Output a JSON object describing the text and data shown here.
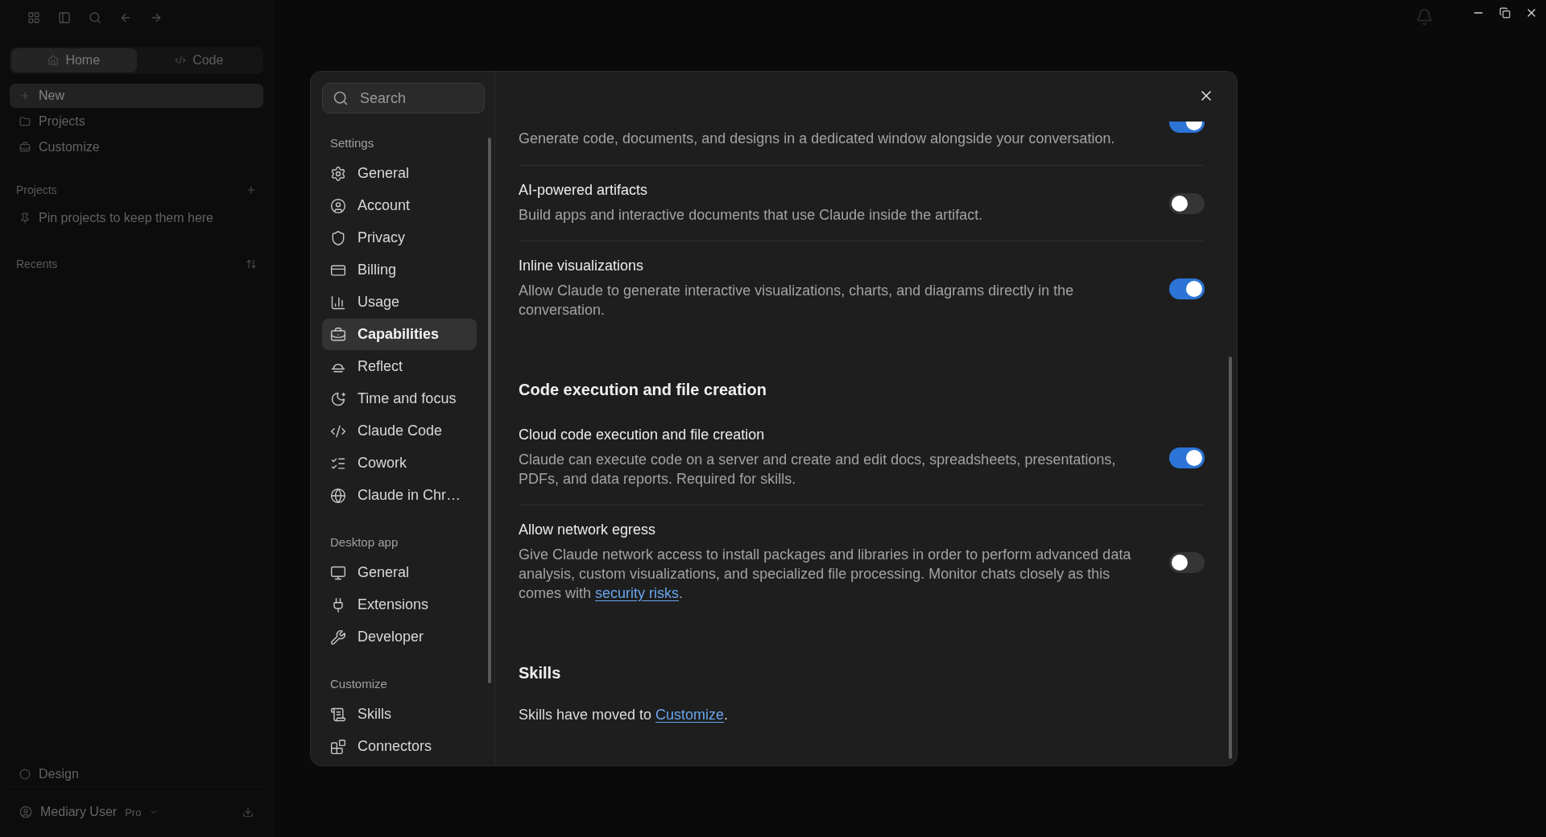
{
  "app_sidebar": {
    "tabs": [
      {
        "label": "Home",
        "selected": true
      },
      {
        "label": "Code",
        "selected": false
      }
    ],
    "nav": [
      {
        "label": "New",
        "selected": true
      },
      {
        "label": "Projects",
        "selected": false
      },
      {
        "label": "Customize",
        "selected": false
      }
    ],
    "projects_heading": "Projects",
    "projects_empty": "Pin projects to keep them here",
    "recents_heading": "Recents",
    "footer_item": "Design",
    "user": {
      "name": "Mediary User",
      "plan": "Pro"
    }
  },
  "settings": {
    "search": {
      "placeholder": "Search"
    },
    "nav_groups": [
      {
        "heading": "Settings",
        "items": [
          {
            "label": "General",
            "selected": false
          },
          {
            "label": "Account",
            "selected": false
          },
          {
            "label": "Privacy",
            "selected": false
          },
          {
            "label": "Billing",
            "selected": false
          },
          {
            "label": "Usage",
            "selected": false
          },
          {
            "label": "Capabilities",
            "selected": true
          },
          {
            "label": "Reflect",
            "selected": false
          },
          {
            "label": "Time and focus",
            "selected": false
          },
          {
            "label": "Claude Code",
            "selected": false
          },
          {
            "label": "Cowork",
            "selected": false
          },
          {
            "label": "Claude in Chr…",
            "selected": false
          }
        ]
      },
      {
        "heading": "Desktop app",
        "items": [
          {
            "label": "General",
            "selected": false
          },
          {
            "label": "Extensions",
            "selected": false
          },
          {
            "label": "Developer",
            "selected": false
          }
        ]
      },
      {
        "heading": "Customize",
        "items": [
          {
            "label": "Skills",
            "selected": false
          },
          {
            "label": "Connectors",
            "selected": false
          }
        ]
      }
    ],
    "rows": [
      {
        "kind": "setting",
        "description": "Generate code, documents, and designs in a dedicated window alongside your conversation.",
        "on": true
      },
      {
        "kind": "setting",
        "title": "AI-powered artifacts",
        "description": "Build apps and interactive documents that use Claude inside the artifact.",
        "on": false
      },
      {
        "kind": "setting",
        "title": "Inline visualizations",
        "description": "Allow Claude to generate interactive visualizations, charts, and diagrams directly in the conversation.",
        "on": true
      },
      {
        "kind": "heading",
        "text": "Code execution and file creation"
      },
      {
        "kind": "setting",
        "title": "Cloud code execution and file creation",
        "description": "Claude can execute code on a server and create and edit docs, spreadsheets, presentations, PDFs, and data reports. Required for skills.",
        "on": true
      },
      {
        "kind": "setting",
        "title": "Allow network egress",
        "description": "Give Claude network access to install packages and libraries in order to perform advanced data analysis, custom visualizations, and specialized file processing. Monitor chats closely as this comes with ",
        "link": "security risks",
        "after": ".",
        "on": false
      },
      {
        "kind": "heading",
        "text": "Skills"
      },
      {
        "kind": "note",
        "text": "Skills have moved to ",
        "link": "Customize",
        "after": "."
      }
    ]
  }
}
